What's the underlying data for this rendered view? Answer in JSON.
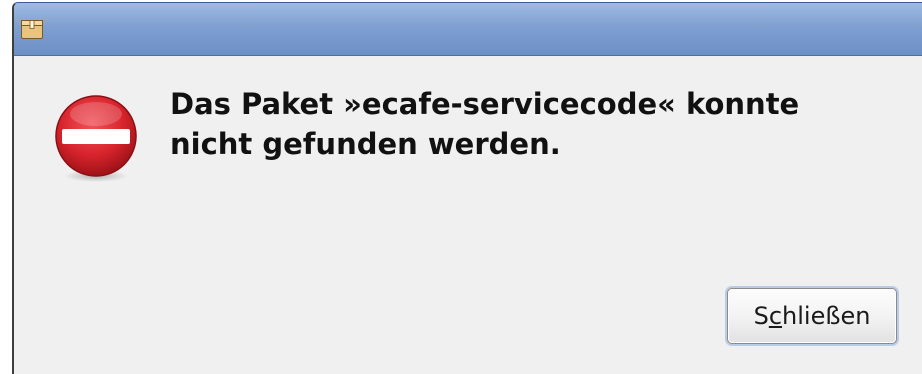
{
  "dialog": {
    "window_icon": "package-icon",
    "status_icon": "error-icon",
    "message_line1": "Das Paket »ecafe-servicecode« konnte",
    "message_line2": "nicht gefunden werden.",
    "close_button": {
      "label_before": "S",
      "label_mnemonic": "c",
      "label_after": "hließen"
    }
  },
  "colors": {
    "titlebar": "#7fa0d1",
    "error_red": "#d8242c",
    "background": "#eff0ef"
  }
}
